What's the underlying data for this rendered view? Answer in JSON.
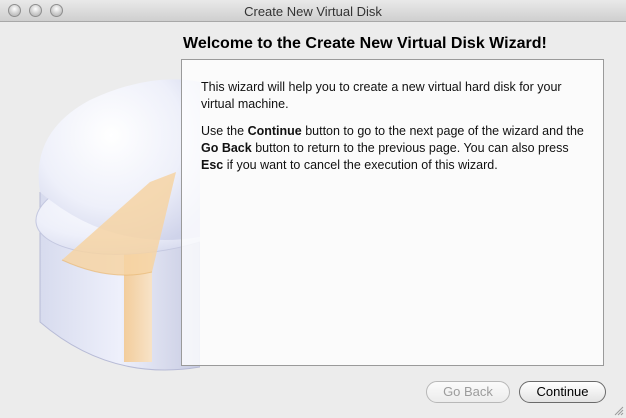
{
  "window": {
    "title": "Create New Virtual Disk"
  },
  "wizard": {
    "heading": "Welcome to the Create New Virtual Disk Wizard!",
    "paragraph1": "This wizard will help you to create a new virtual hard disk for your virtual machine.",
    "paragraph2": {
      "t1": "Use the ",
      "b1": "Continue",
      "t2": " button to go to the next page of the wizard and the ",
      "b2": "Go Back",
      "t3": " button to return to the previous page. You can also press ",
      "b3": "Esc",
      "t4": " if you want to cancel the execution of this wizard."
    }
  },
  "buttons": {
    "go_back": "Go Back",
    "continue": "Continue"
  },
  "icons": {
    "disk": "virtual-disk-icon"
  },
  "colors": {
    "window_bg": "#ececec",
    "panel_border": "#9a9a9a",
    "disk_accent": "#f6d3a3"
  }
}
